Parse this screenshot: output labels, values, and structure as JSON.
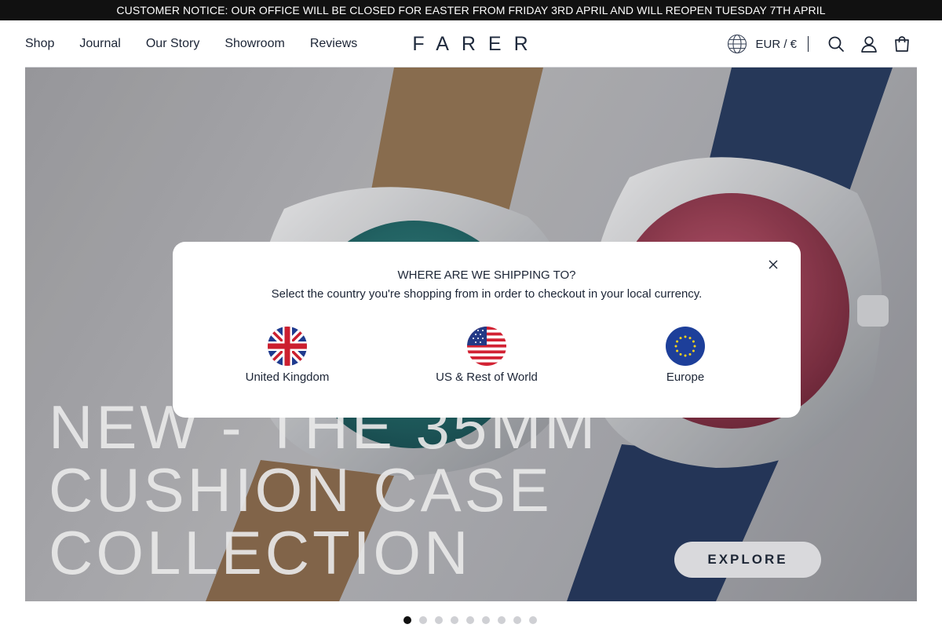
{
  "notice": {
    "text": "CUSTOMER NOTICE: OUR OFFICE WILL BE CLOSED FOR EASTER FROM FRIDAY 3RD APRIL AND WILL REOPEN TUESDAY 7TH APRIL"
  },
  "header": {
    "nav": [
      {
        "label": "Shop"
      },
      {
        "label": "Journal"
      },
      {
        "label": "Our Story"
      },
      {
        "label": "Showroom"
      },
      {
        "label": "Reviews"
      }
    ],
    "logo": "FARER",
    "currency": "EUR / €",
    "icons": [
      "globe-icon",
      "search-icon",
      "account-icon",
      "cart-icon"
    ]
  },
  "hero": {
    "title_lines": [
      "NEW - THE 35MM",
      "CUSHION CASE",
      "COLLECTION"
    ],
    "cta_label": "EXPLORE",
    "slides_total": 9,
    "active_slide": 1
  },
  "modal": {
    "title": "WHERE ARE WE SHIPPING TO?",
    "subtitle": "Select the country you're shopping from in order to checkout in your local currency.",
    "options": [
      {
        "label": "United Kingdom",
        "icon": "uk-flag-icon"
      },
      {
        "label": "US & Rest of World",
        "icon": "us-flag-icon"
      },
      {
        "label": "Europe",
        "icon": "eu-flag-icon"
      }
    ],
    "close_icon": "close-icon"
  },
  "colors": {
    "notice_bg": "#111111",
    "text": "#1c2536",
    "button_bg": "#e7e7ea",
    "teal_dial": "#1f6b6a",
    "red_dial": "#a5384f",
    "navy_strap": "#263a5e",
    "tan_strap": "#9a7853"
  }
}
